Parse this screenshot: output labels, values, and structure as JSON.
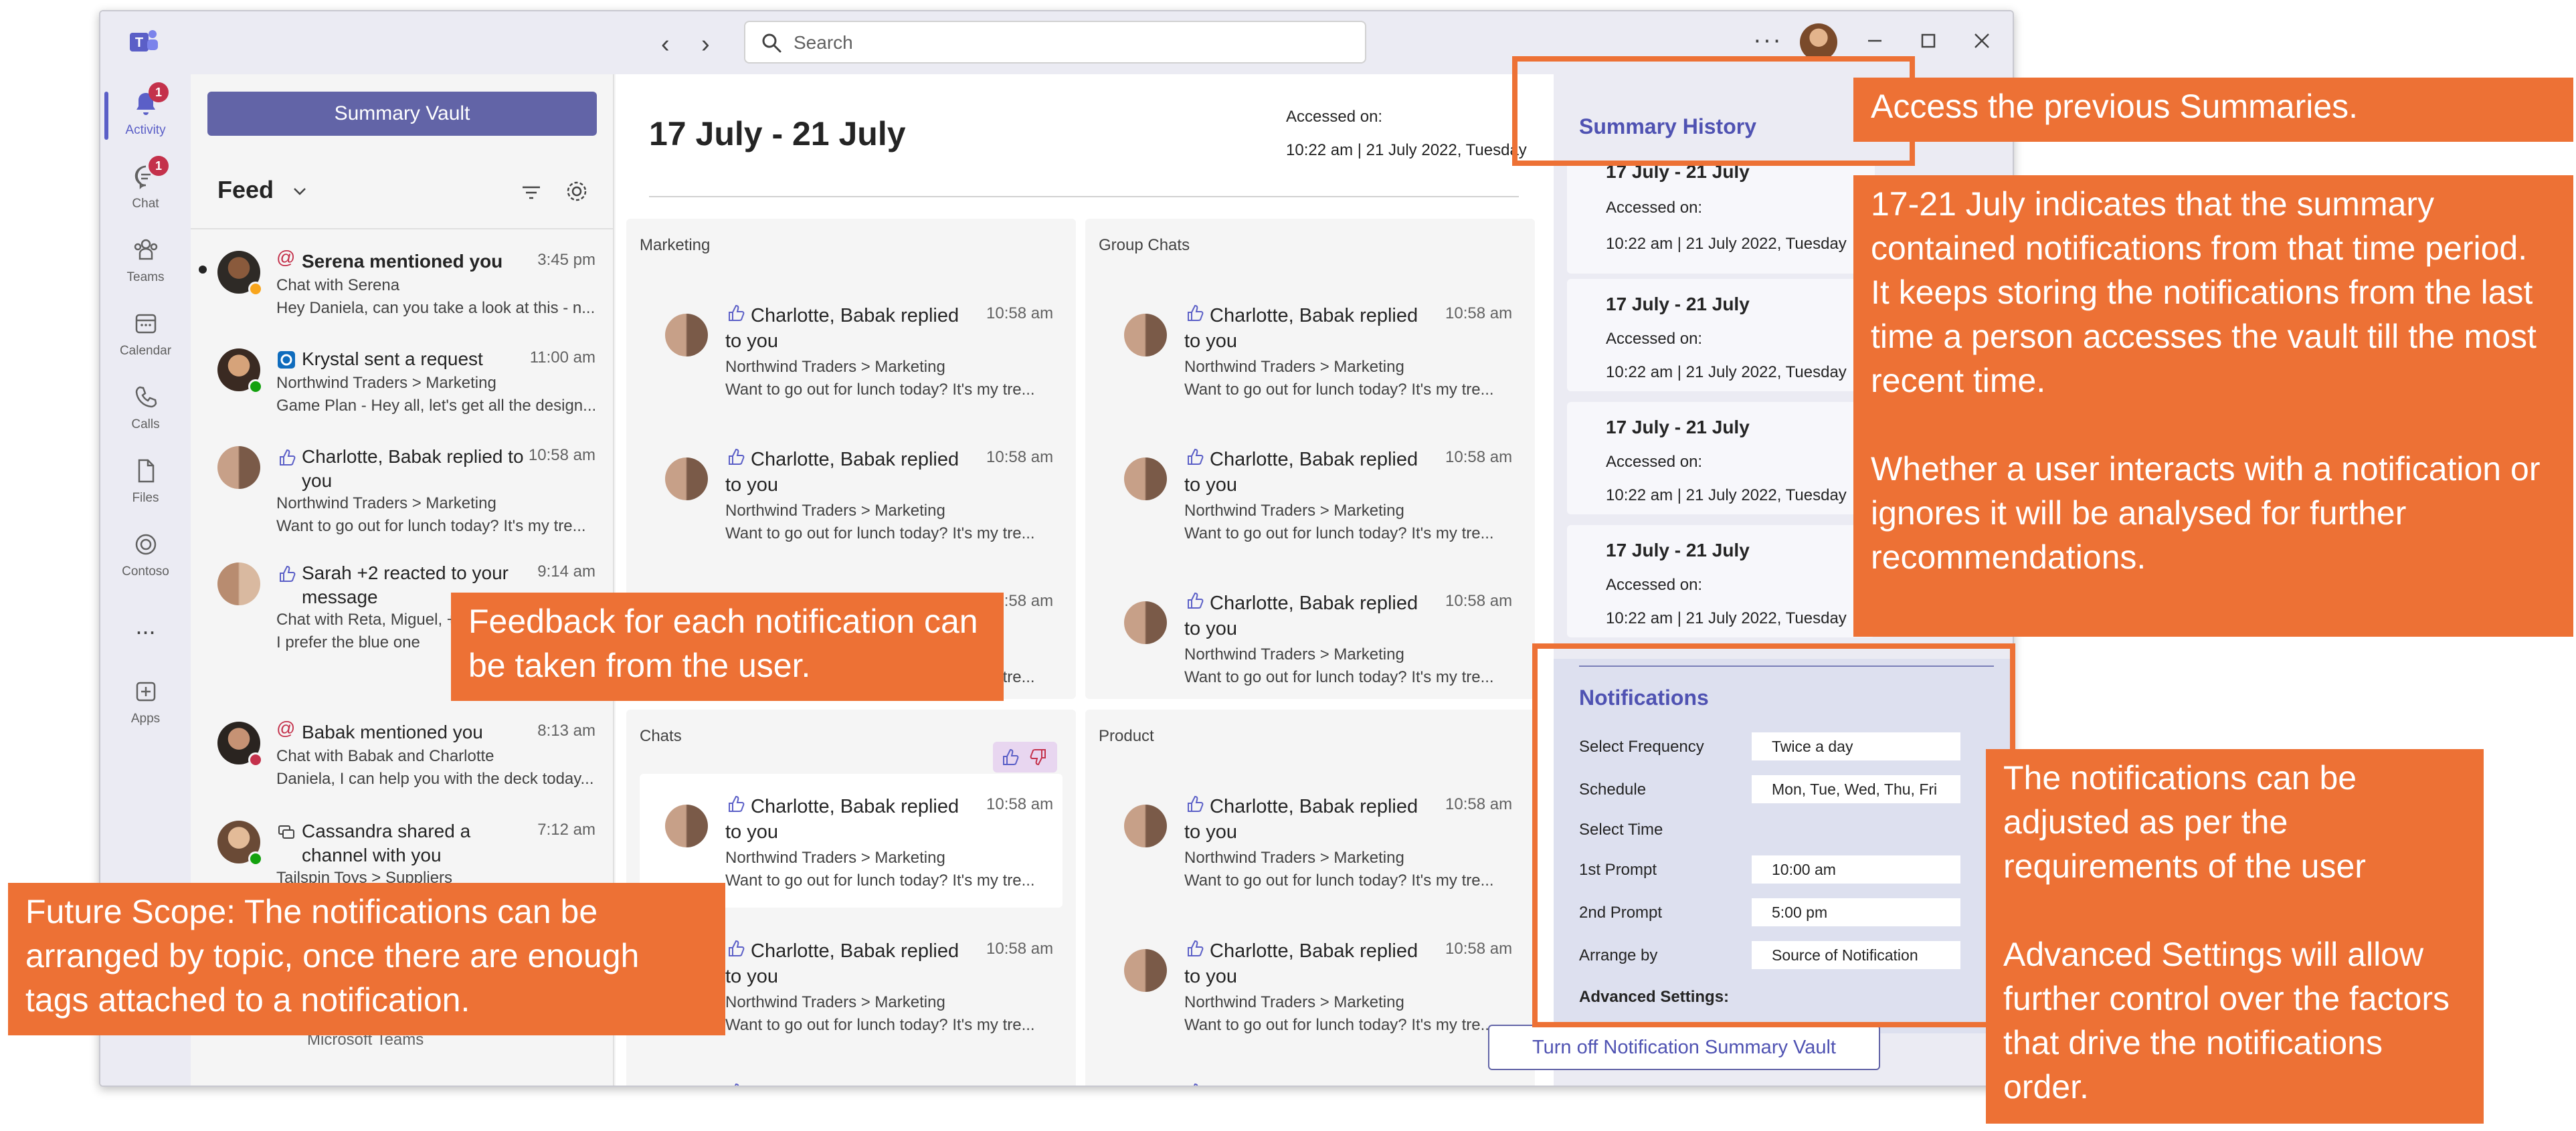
{
  "search": {
    "placeholder": "Search"
  },
  "rail": [
    {
      "label": "Activity",
      "badge": "1"
    },
    {
      "label": "Chat",
      "badge": "1"
    },
    {
      "label": "Teams"
    },
    {
      "label": "Calendar"
    },
    {
      "label": "Calls"
    },
    {
      "label": "Files"
    },
    {
      "label": "Contoso"
    },
    {
      "label": "..."
    },
    {
      "label": "Apps"
    }
  ],
  "feed": {
    "vault_button": "Summary Vault",
    "title": "Feed",
    "items": [
      {
        "title": "Serena mentioned you",
        "time": "3:45 pm",
        "line1": "Chat with Serena",
        "line2": "Hey Daniela, can you take a look at this - n..."
      },
      {
        "title": "Krystal sent a request",
        "time": "11:00 am",
        "line1": "Northwind Traders > Marketing",
        "line2": "Game Plan - Hey all, let's get all the design..."
      },
      {
        "title": "Charlotte, Babak replied to you",
        "time": "10:58 am",
        "line1": "Northwind Traders > Marketing",
        "line2": "Want to go out for lunch today? It's my tre..."
      },
      {
        "title": "Sarah +2 reacted to your message",
        "time": "9:14 am",
        "line1": "Chat with Reta, Miguel, +1",
        "line2": "I prefer the blue one"
      },
      {
        "title": "Babak mentioned you",
        "time": "8:13 am",
        "line1": "Chat with Babak and Charlotte",
        "line2": "Daniela, I can help you with the deck today..."
      },
      {
        "title": "Cassandra shared a channel with you",
        "time": "7:12 am",
        "line1": "Tailspin Toys > Suppliers",
        "line2": ""
      }
    ],
    "footer_partial": "Microsoft Teams"
  },
  "main": {
    "date_title": "17 July - 21 July",
    "accessed_label": "Accessed on:",
    "accessed_value": "10:22 am | 21 July 2022, Tuesday",
    "sections": [
      {
        "title": "Marketing"
      },
      {
        "title": "Group Chats"
      },
      {
        "title": "Chats"
      },
      {
        "title": "Product"
      }
    ],
    "card": {
      "title": "Charlotte, Babak replied to you",
      "time": "10:58 am",
      "line1": "Northwind Traders > Marketing",
      "line2": "Want to go out for lunch today? It's my tre..."
    }
  },
  "history": {
    "title": "Summary History",
    "items": [
      {
        "range": "17 July - 21 July",
        "label": "Accessed on:",
        "value": "10:22 am | 21 July 2022, Tuesday"
      },
      {
        "range": "17 July - 21 July",
        "label": "Accessed on:",
        "value": "10:22 am | 21 July 2022, Tuesday"
      },
      {
        "range": "17 July - 21 July",
        "label": "Accessed on:",
        "value": "10:22 am | 21 July 2022, Tuesday"
      },
      {
        "range": "17 July - 21 July",
        "label": "Accessed on:",
        "value": "10:22 am | 21 July 2022, Tuesday"
      }
    ]
  },
  "notifications": {
    "title": "Notifications",
    "frequency_label": "Select Frequency",
    "frequency_value": "Twice a day",
    "schedule_label": "Schedule",
    "schedule_value": "Mon, Tue, Wed, Thu, Fri",
    "time_label": "Select Time",
    "prompt1_label": "1st Prompt",
    "prompt1_value": "10:00 am",
    "prompt2_label": "2nd Prompt",
    "prompt2_value": "5:00 pm",
    "arrange_label": "Arrange by",
    "arrange_value": "Source of Notification",
    "advanced_label": "Advanced Settings:",
    "turnoff_button": "Turn off Notification Summary Vault"
  },
  "annotations": {
    "history": "Access the previous Summaries.",
    "range": "17-21 July indicates that the summary contained notifications from that time period.\nIt keeps storing the notifications from the last time a person accesses the vault till the most recent time.\n\nWhether a user interacts with a notification or ignores it will be analysed for further recommendations.",
    "feedback": "Feedback for each notification can be taken from the user.",
    "future": "Future Scope: The notifications can be arranged by topic, once there are enough tags attached to a notification.",
    "settings": "The notifications can be adjusted as per the requirements of the user\n\nAdvanced Settings will allow further control over the factors that drive the notifications order."
  },
  "colors": {
    "brand": "#6264a7",
    "accent": "#ed7135",
    "badge": "#c4314b",
    "online": "#13a10e",
    "busy": "#c4314b"
  }
}
